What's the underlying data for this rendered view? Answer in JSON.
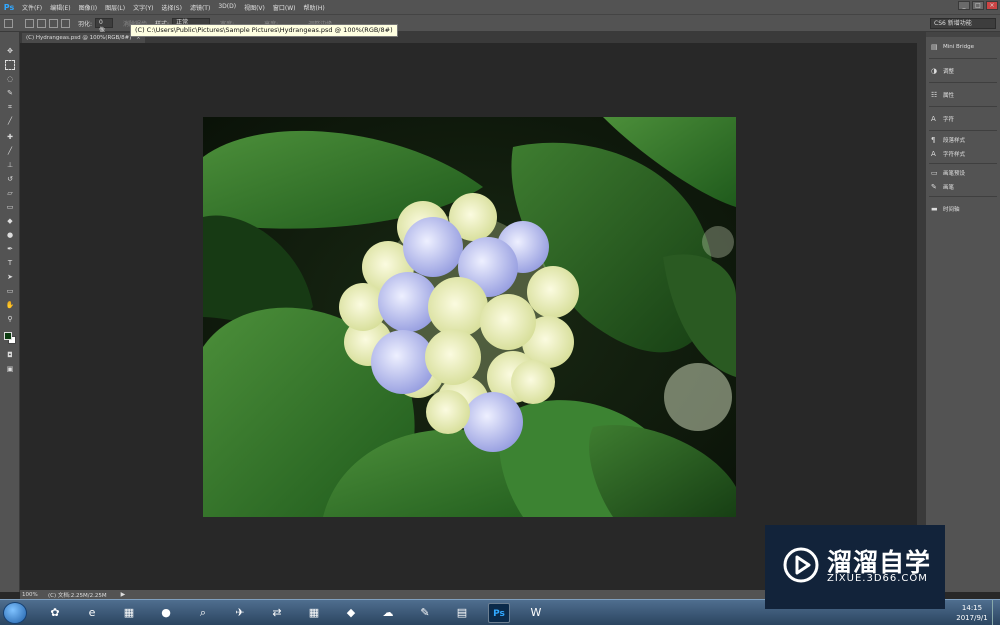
{
  "app": {
    "logo": "Ps",
    "menu": [
      "文件(F)",
      "编辑(E)",
      "图像(I)",
      "图层(L)",
      "文字(Y)",
      "选择(S)",
      "滤镜(T)",
      "3D(D)",
      "视图(V)",
      "窗口(W)",
      "帮助(H)"
    ],
    "window_buttons": [
      "_",
      "□",
      "×"
    ]
  },
  "options_bar": {
    "feather_label": "羽化:",
    "feather_value": "0 像素",
    "dim1": "消除锯齿",
    "style_label": "样式:",
    "style_value": "正常",
    "dim2": "宽度:",
    "dim3": "高度:",
    "dim4": "调整边缘...",
    "workspace": "CS6 新增功能"
  },
  "tooltip": "(C) C:\\Users\\Public\\Pictures\\Sample Pictures\\Hydrangeas.psd @ 100%(RGB/8#)",
  "document_tab": {
    "label": "(C) Hydrangeas.psd @ 100%(RGB/8#)",
    "close": "×"
  },
  "tools": [
    "move-icon",
    "marquee-icon",
    "lasso-icon",
    "quick-select-icon",
    "crop-icon",
    "eyedropper-icon",
    "healing-icon",
    "brush-icon",
    "stamp-icon",
    "history-brush-icon",
    "eraser-icon",
    "gradient-icon",
    "blur-icon",
    "dodge-icon",
    "pen-icon",
    "type-icon",
    "path-select-icon",
    "shape-icon",
    "hand-icon",
    "zoom-icon"
  ],
  "colors": {
    "foreground": "#0d3d12",
    "background": "#ffffff"
  },
  "panel_items": [
    {
      "icon": "mini-bridge-icon",
      "glyph": "▤",
      "label": "Mini Bridge"
    },
    {
      "icon": "adjustments-icon",
      "glyph": "◑",
      "label": "调整"
    },
    {
      "icon": "properties-icon",
      "glyph": "☷",
      "label": "属性"
    },
    {
      "icon": "character-icon",
      "glyph": "A",
      "label": "字符"
    },
    {
      "icon": "paragraph-style-icon",
      "glyph": "¶",
      "label": "段落样式"
    },
    {
      "icon": "character-style-icon",
      "glyph": "A",
      "label": "字符样式"
    },
    {
      "icon": "brush-preset-icon",
      "glyph": "▭",
      "label": "画笔预设"
    },
    {
      "icon": "brush-panel-icon",
      "glyph": "✎",
      "label": "画笔"
    },
    {
      "icon": "timeline-icon",
      "glyph": "▬",
      "label": "时间轴"
    }
  ],
  "status": {
    "zoom": "100%",
    "doc": "(C) 文档:2.25M/2.25M",
    "arrow": "▶"
  },
  "taskbar": {
    "clock_time": "14:15",
    "clock_date": "2017/9/1",
    "apps": [
      {
        "name": "paint-icon",
        "glyph": "✿"
      },
      {
        "name": "ie-icon",
        "glyph": "e"
      },
      {
        "name": "folder-icon",
        "glyph": "▦"
      },
      {
        "name": "firefox-icon",
        "glyph": "●"
      },
      {
        "name": "search-app-icon",
        "glyph": "⌕"
      },
      {
        "name": "bird-app-icon",
        "glyph": "✈"
      },
      {
        "name": "network-icon",
        "glyph": "⇄"
      },
      {
        "name": "tiles-app-icon",
        "glyph": "▦"
      },
      {
        "name": "3d-app-icon",
        "glyph": "◆"
      },
      {
        "name": "cloud-app-icon",
        "glyph": "☁"
      },
      {
        "name": "paint-palette-icon",
        "glyph": "✎"
      },
      {
        "name": "calculator-icon",
        "glyph": "▤"
      },
      {
        "name": "photoshop-icon",
        "glyph": "Ps"
      },
      {
        "name": "wps-icon",
        "glyph": "W"
      }
    ]
  },
  "watermark": {
    "title": "溜溜自学",
    "url": "ZIXUE.3D66.COM"
  }
}
